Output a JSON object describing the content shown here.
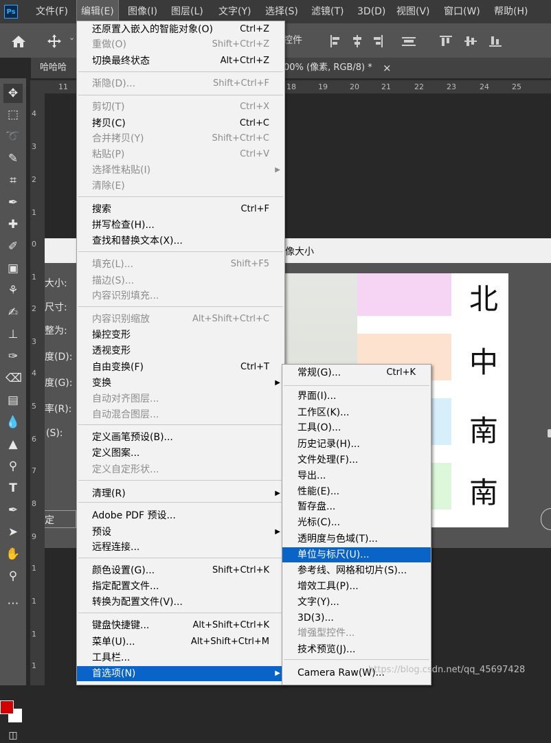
{
  "menubar": {
    "logo": "Ps",
    "items": [
      "文件(F)",
      "编辑(E)",
      "图像(I)",
      "图层(L)",
      "文字(Y)",
      "选择(S)",
      "滤镜(T)",
      "3D(D)",
      "视图(V)",
      "窗口(W)",
      "帮助(H)"
    ]
  },
  "optionsbar": {
    "partial_label": "控件"
  },
  "tabs": {
    "left": "哈哈哈",
    "right": "00% (像素, RGB/8) *",
    "close": "×"
  },
  "ruler_top": [
    "11",
    "18",
    "19",
    "20",
    "21",
    "22",
    "23",
    "24",
    "25"
  ],
  "ruler_left": [
    "4",
    "3",
    "2",
    "1",
    "0",
    "1",
    "2",
    "3",
    "4",
    "5",
    "6",
    "7",
    "8",
    "9",
    "1",
    "1",
    "1",
    "1"
  ],
  "dialog": {
    "title": "像大小",
    "labels": [
      "大小:",
      "尺寸:",
      "整为:",
      "度(D):",
      "度(G):",
      "率(R):",
      "(S):",
      "定"
    ]
  },
  "preview": {
    "chars": [
      "北",
      "中",
      "南",
      "南"
    ],
    "swatch_colors": [
      "#f6d4f3",
      "#fde3cf",
      "#d6effb",
      "#dcf7d9"
    ]
  },
  "edit_menu": {
    "items": [
      {
        "label": "还原置入嵌入的智能对象(O)",
        "shortcut": "Ctrl+Z",
        "disabled": false
      },
      {
        "label": "重做(O)",
        "shortcut": "Shift+Ctrl+Z",
        "disabled": true
      },
      {
        "label": "切换最终状态",
        "shortcut": "Alt+Ctrl+Z",
        "disabled": false
      },
      {
        "label": "渐隐(D)...",
        "shortcut": "Shift+Ctrl+F",
        "disabled": true
      },
      {
        "label": "剪切(T)",
        "shortcut": "Ctrl+X",
        "disabled": true
      },
      {
        "label": "拷贝(C)",
        "shortcut": "Ctrl+C",
        "disabled": false
      },
      {
        "label": "合并拷贝(Y)",
        "shortcut": "Shift+Ctrl+C",
        "disabled": true
      },
      {
        "label": "粘贴(P)",
        "shortcut": "Ctrl+V",
        "disabled": true
      },
      {
        "label": "选择性粘贴(I)",
        "shortcut": "",
        "disabled": true,
        "submenu": true
      },
      {
        "label": "清除(E)",
        "shortcut": "",
        "disabled": true
      },
      {
        "label": "搜索",
        "shortcut": "Ctrl+F",
        "disabled": false
      },
      {
        "label": "拼写检查(H)...",
        "shortcut": "",
        "disabled": false
      },
      {
        "label": "查找和替换文本(X)...",
        "shortcut": "",
        "disabled": false
      },
      {
        "label": "填充(L)...",
        "shortcut": "Shift+F5",
        "disabled": true
      },
      {
        "label": "描边(S)...",
        "shortcut": "",
        "disabled": true
      },
      {
        "label": "内容识别填充...",
        "shortcut": "",
        "disabled": true
      },
      {
        "label": "内容识别缩放",
        "shortcut": "Alt+Shift+Ctrl+C",
        "disabled": true
      },
      {
        "label": "操控变形",
        "shortcut": "",
        "disabled": false
      },
      {
        "label": "透视变形",
        "shortcut": "",
        "disabled": false
      },
      {
        "label": "自由变换(F)",
        "shortcut": "Ctrl+T",
        "disabled": false
      },
      {
        "label": "变换",
        "shortcut": "",
        "disabled": false,
        "submenu": true
      },
      {
        "label": "自动对齐图层...",
        "shortcut": "",
        "disabled": true
      },
      {
        "label": "自动混合图层...",
        "shortcut": "",
        "disabled": true
      },
      {
        "label": "定义画笔预设(B)...",
        "shortcut": "",
        "disabled": false
      },
      {
        "label": "定义图案...",
        "shortcut": "",
        "disabled": false
      },
      {
        "label": "定义自定形状...",
        "shortcut": "",
        "disabled": true
      },
      {
        "label": "清理(R)",
        "shortcut": "",
        "disabled": false,
        "submenu": true
      },
      {
        "label": "Adobe PDF 预设...",
        "shortcut": "",
        "disabled": false
      },
      {
        "label": "预设",
        "shortcut": "",
        "disabled": false,
        "submenu": true
      },
      {
        "label": "远程连接...",
        "shortcut": "",
        "disabled": false
      },
      {
        "label": "颜色设置(G)...",
        "shortcut": "Shift+Ctrl+K",
        "disabled": false
      },
      {
        "label": "指定配置文件...",
        "shortcut": "",
        "disabled": false
      },
      {
        "label": "转换为配置文件(V)...",
        "shortcut": "",
        "disabled": false
      },
      {
        "label": "键盘快捷键...",
        "shortcut": "Alt+Shift+Ctrl+K",
        "disabled": false
      },
      {
        "label": "菜单(U)...",
        "shortcut": "Alt+Shift+Ctrl+M",
        "disabled": false
      },
      {
        "label": "工具栏...",
        "shortcut": "",
        "disabled": false
      },
      {
        "label": "首选项(N)",
        "shortcut": "",
        "disabled": false,
        "submenu": true,
        "highlighted": true
      }
    ]
  },
  "prefs_menu": {
    "items": [
      {
        "label": "常规(G)...",
        "shortcut": "Ctrl+K",
        "disabled": false
      },
      {
        "label": "界面(I)...",
        "shortcut": "",
        "disabled": false
      },
      {
        "label": "工作区(K)...",
        "shortcut": "",
        "disabled": false
      },
      {
        "label": "工具(O)...",
        "shortcut": "",
        "disabled": false
      },
      {
        "label": "历史记录(H)...",
        "shortcut": "",
        "disabled": false
      },
      {
        "label": "文件处理(F)...",
        "shortcut": "",
        "disabled": false
      },
      {
        "label": "导出...",
        "shortcut": "",
        "disabled": false
      },
      {
        "label": "性能(E)...",
        "shortcut": "",
        "disabled": false
      },
      {
        "label": "暂存盘...",
        "shortcut": "",
        "disabled": false
      },
      {
        "label": "光标(C)...",
        "shortcut": "",
        "disabled": false
      },
      {
        "label": "透明度与色域(T)...",
        "shortcut": "",
        "disabled": false
      },
      {
        "label": "单位与标尺(U)...",
        "shortcut": "",
        "disabled": false,
        "highlighted": true
      },
      {
        "label": "参考线、网格和切片(S)...",
        "shortcut": "",
        "disabled": false
      },
      {
        "label": "增效工具(P)...",
        "shortcut": "",
        "disabled": false
      },
      {
        "label": "文字(Y)...",
        "shortcut": "",
        "disabled": false
      },
      {
        "label": "3D(3)...",
        "shortcut": "",
        "disabled": false
      },
      {
        "label": "增强型控件...",
        "shortcut": "",
        "disabled": true
      },
      {
        "label": "技术预览(J)...",
        "shortcut": "",
        "disabled": false
      },
      {
        "label": "Camera Raw(W)...",
        "shortcut": "",
        "disabled": false
      }
    ]
  },
  "colors": {
    "foreground": "#d20000",
    "background": "#ffffff",
    "highlight": "#0a64c8"
  },
  "watermark": "https://blog.csdn.net/qq_45697428"
}
